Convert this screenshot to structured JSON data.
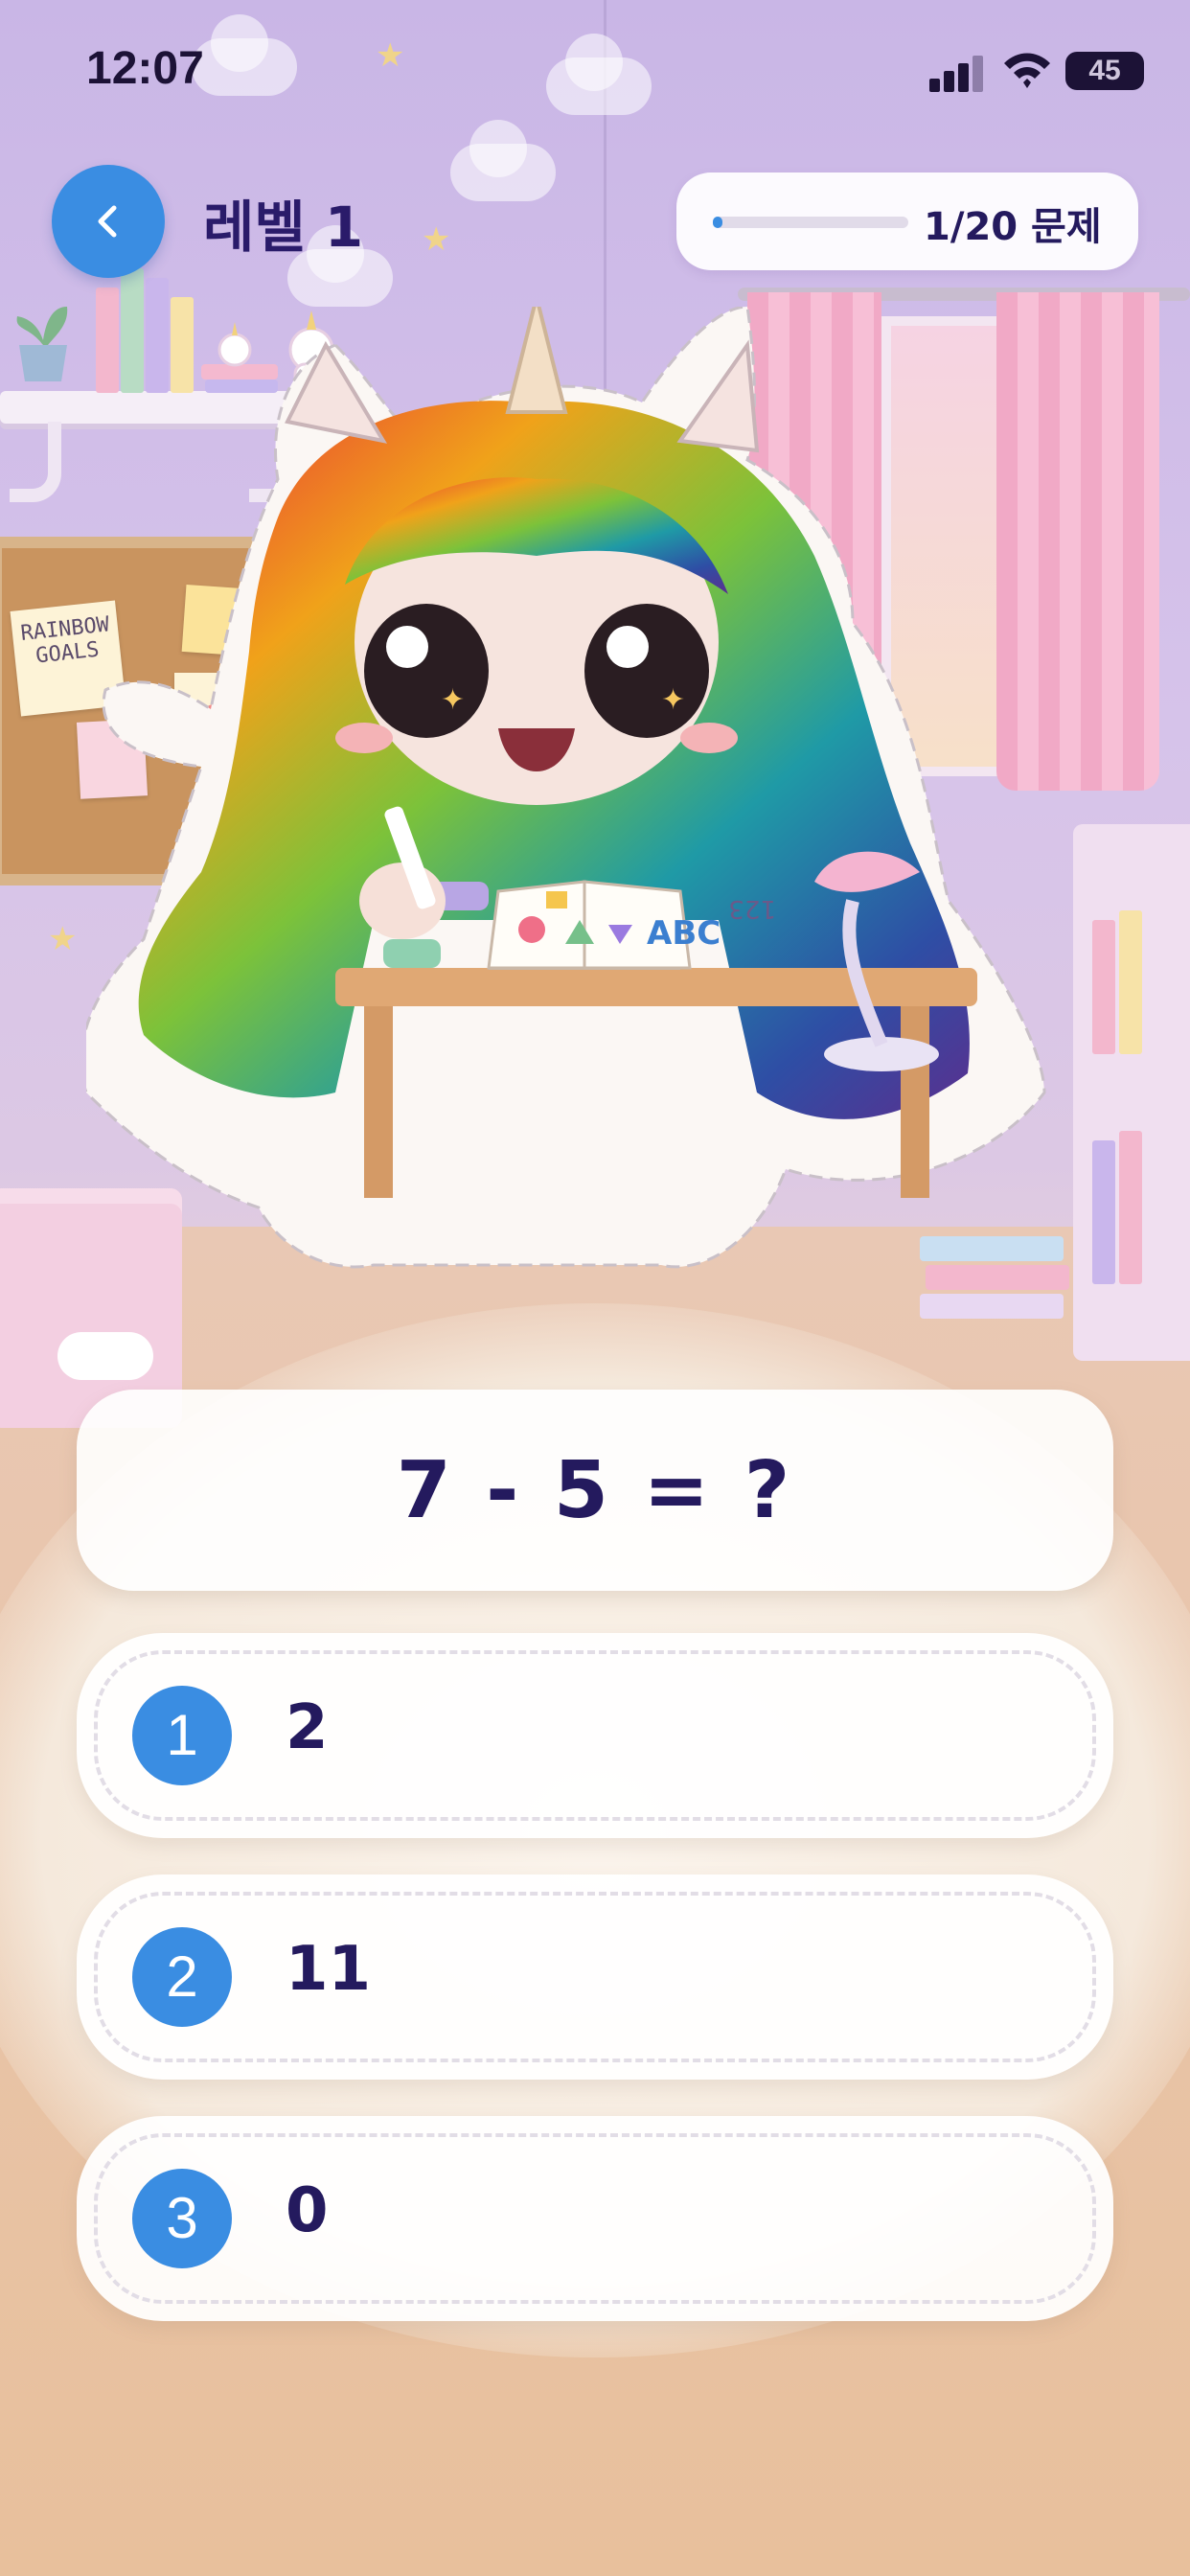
{
  "status_bar": {
    "time": "12:07",
    "battery": "45"
  },
  "header": {
    "back_icon": "chevron-left-icon",
    "level_title": "레벨 1",
    "progress_label": "1/20 문제",
    "progress_fraction": 0.05
  },
  "background": {
    "corkboard_note": "RAINBOW GOALS",
    "book_letters": "ABC",
    "book_numbers": "123"
  },
  "question": {
    "text": "7 - 5 = ?"
  },
  "answers": [
    {
      "number": "1",
      "value": "2"
    },
    {
      "number": "2",
      "value": "11"
    },
    {
      "number": "3",
      "value": "0"
    }
  ],
  "colors": {
    "accent": "#3a8de2",
    "text": "#241a5e"
  }
}
